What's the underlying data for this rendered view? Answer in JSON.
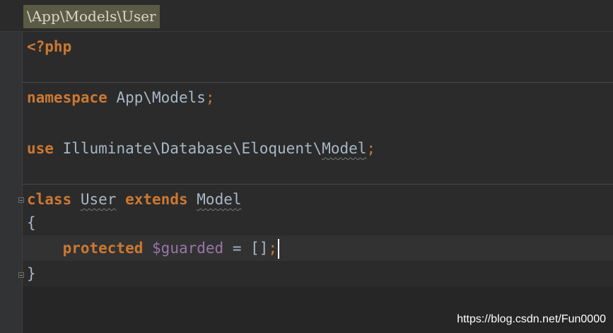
{
  "breadcrumb": "\\App\\Models\\User",
  "code": {
    "open_tag": "<?php",
    "namespace_kw": "namespace",
    "namespace_name": "App\\Models",
    "semicolon": ";",
    "use_kw": "use",
    "use_path": "Illuminate\\Database\\Eloquent\\",
    "use_class": "Model",
    "class_kw": "class",
    "class_name": "User",
    "extends_kw": "extends",
    "parent_class": "Model",
    "open_brace": "{",
    "protected_kw": "protected",
    "property": "$guarded",
    "equals": "=",
    "array_value": "[]",
    "close_brace": "}"
  },
  "watermark": "https://blog.csdn.net/Fun0000",
  "colors": {
    "keyword": "#cc7832",
    "variable": "#9876aa",
    "text": "#a9b7c6",
    "background": "#2b2b2b"
  }
}
